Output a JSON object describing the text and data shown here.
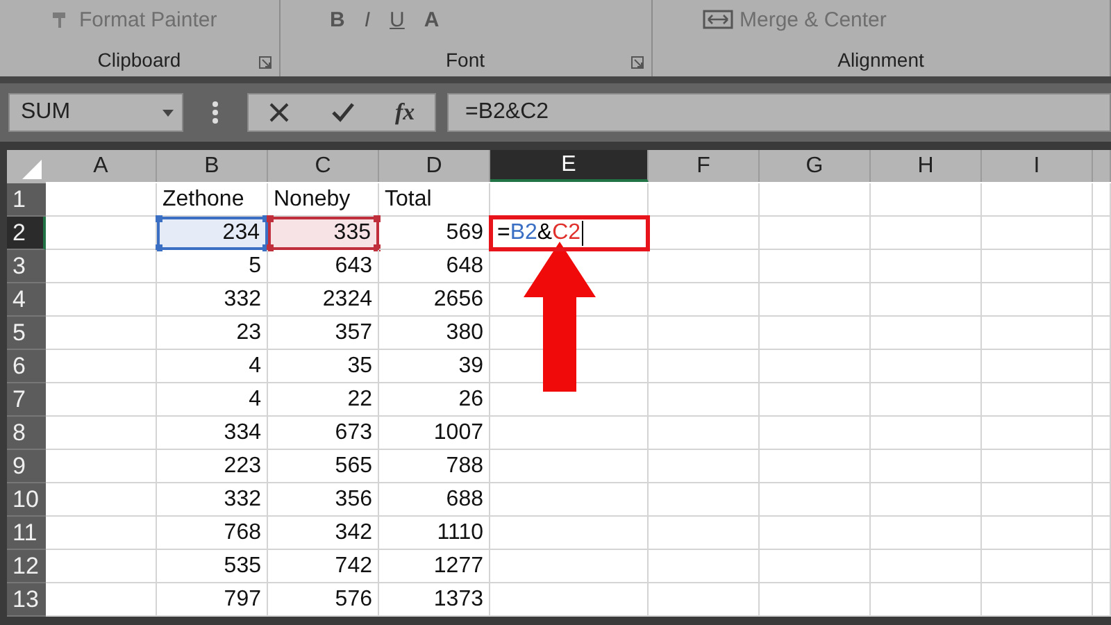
{
  "ribbon": {
    "groups": [
      {
        "name": "Clipboard",
        "buttons": [
          {
            "label": "Format Painter",
            "kind": "painter"
          }
        ],
        "launcher": true
      },
      {
        "name": "Font",
        "buttons": [
          {
            "label": "B",
            "kind": "bold"
          },
          {
            "label": "I",
            "kind": "italic"
          },
          {
            "label": "U",
            "kind": "underline"
          },
          {
            "label": "A",
            "kind": "fontcolor"
          }
        ],
        "launcher": true
      },
      {
        "name": "Alignment",
        "buttons": [
          {
            "label": "Merge & Center",
            "kind": "merge"
          }
        ],
        "launcher": false
      }
    ]
  },
  "formula_bar": {
    "name_box": "SUM",
    "function_label": "fx",
    "formula": "=B2&C2"
  },
  "columns": [
    {
      "label": "A",
      "selected": false
    },
    {
      "label": "B",
      "selected": false
    },
    {
      "label": "C",
      "selected": false
    },
    {
      "label": "D",
      "selected": false
    },
    {
      "label": "E",
      "selected": true
    },
    {
      "label": "F",
      "selected": false
    },
    {
      "label": "G",
      "selected": false
    },
    {
      "label": "H",
      "selected": false
    },
    {
      "label": "I",
      "selected": false
    }
  ],
  "rows": [
    {
      "number": "1",
      "selected": false,
      "kind": "text",
      "cells": {
        "B": "Zethone",
        "C": "Noneby",
        "D": "Total"
      }
    },
    {
      "number": "2",
      "selected": true,
      "kind": "number",
      "cells": {
        "B": {
          "text": "234",
          "color": "#3a6fc4"
        },
        "C": {
          "text": "335",
          "color": "#c0303c"
        },
        "D": "569",
        "E": {
          "formula": [
            {
              "text": "=",
              "color": "#000000"
            },
            {
              "text": "B2",
              "color": "#3a6fc4"
            },
            {
              "text": "&",
              "color": "#000000"
            },
            {
              "text": "C2",
              "color": "#e0302c"
            }
          ]
        }
      }
    },
    {
      "number": "3",
      "selected": false,
      "kind": "number",
      "cells": {
        "B": "5",
        "C": "643",
        "D": "648"
      }
    },
    {
      "number": "4",
      "selected": false,
      "kind": "number",
      "cells": {
        "B": "332",
        "C": "2324",
        "D": "2656"
      }
    },
    {
      "number": "5",
      "selected": false,
      "kind": "number",
      "cells": {
        "B": "23",
        "C": "357",
        "D": "380"
      }
    },
    {
      "number": "6",
      "selected": false,
      "kind": "number",
      "cells": {
        "B": "4",
        "C": "35",
        "D": "39"
      }
    },
    {
      "number": "7",
      "selected": false,
      "kind": "number",
      "cells": {
        "B": "4",
        "C": "22",
        "D": "26"
      }
    },
    {
      "number": "8",
      "selected": false,
      "kind": "number",
      "cells": {
        "B": "334",
        "C": "673",
        "D": "1007"
      }
    },
    {
      "number": "9",
      "selected": false,
      "kind": "number",
      "cells": {
        "B": "223",
        "C": "565",
        "D": "788"
      }
    },
    {
      "number": "10",
      "selected": false,
      "kind": "number",
      "cells": {
        "B": "332",
        "C": "356",
        "D": "688"
      }
    },
    {
      "number": "11",
      "selected": false,
      "kind": "number",
      "cells": {
        "B": "768",
        "C": "342",
        "D": "1110"
      }
    },
    {
      "number": "12",
      "selected": false,
      "kind": "number",
      "cells": {
        "B": "535",
        "C": "742",
        "D": "1277"
      }
    },
    {
      "number": "13",
      "selected": false,
      "kind": "number",
      "cells": {
        "B": "797",
        "C": "576",
        "D": "1373"
      }
    }
  ]
}
